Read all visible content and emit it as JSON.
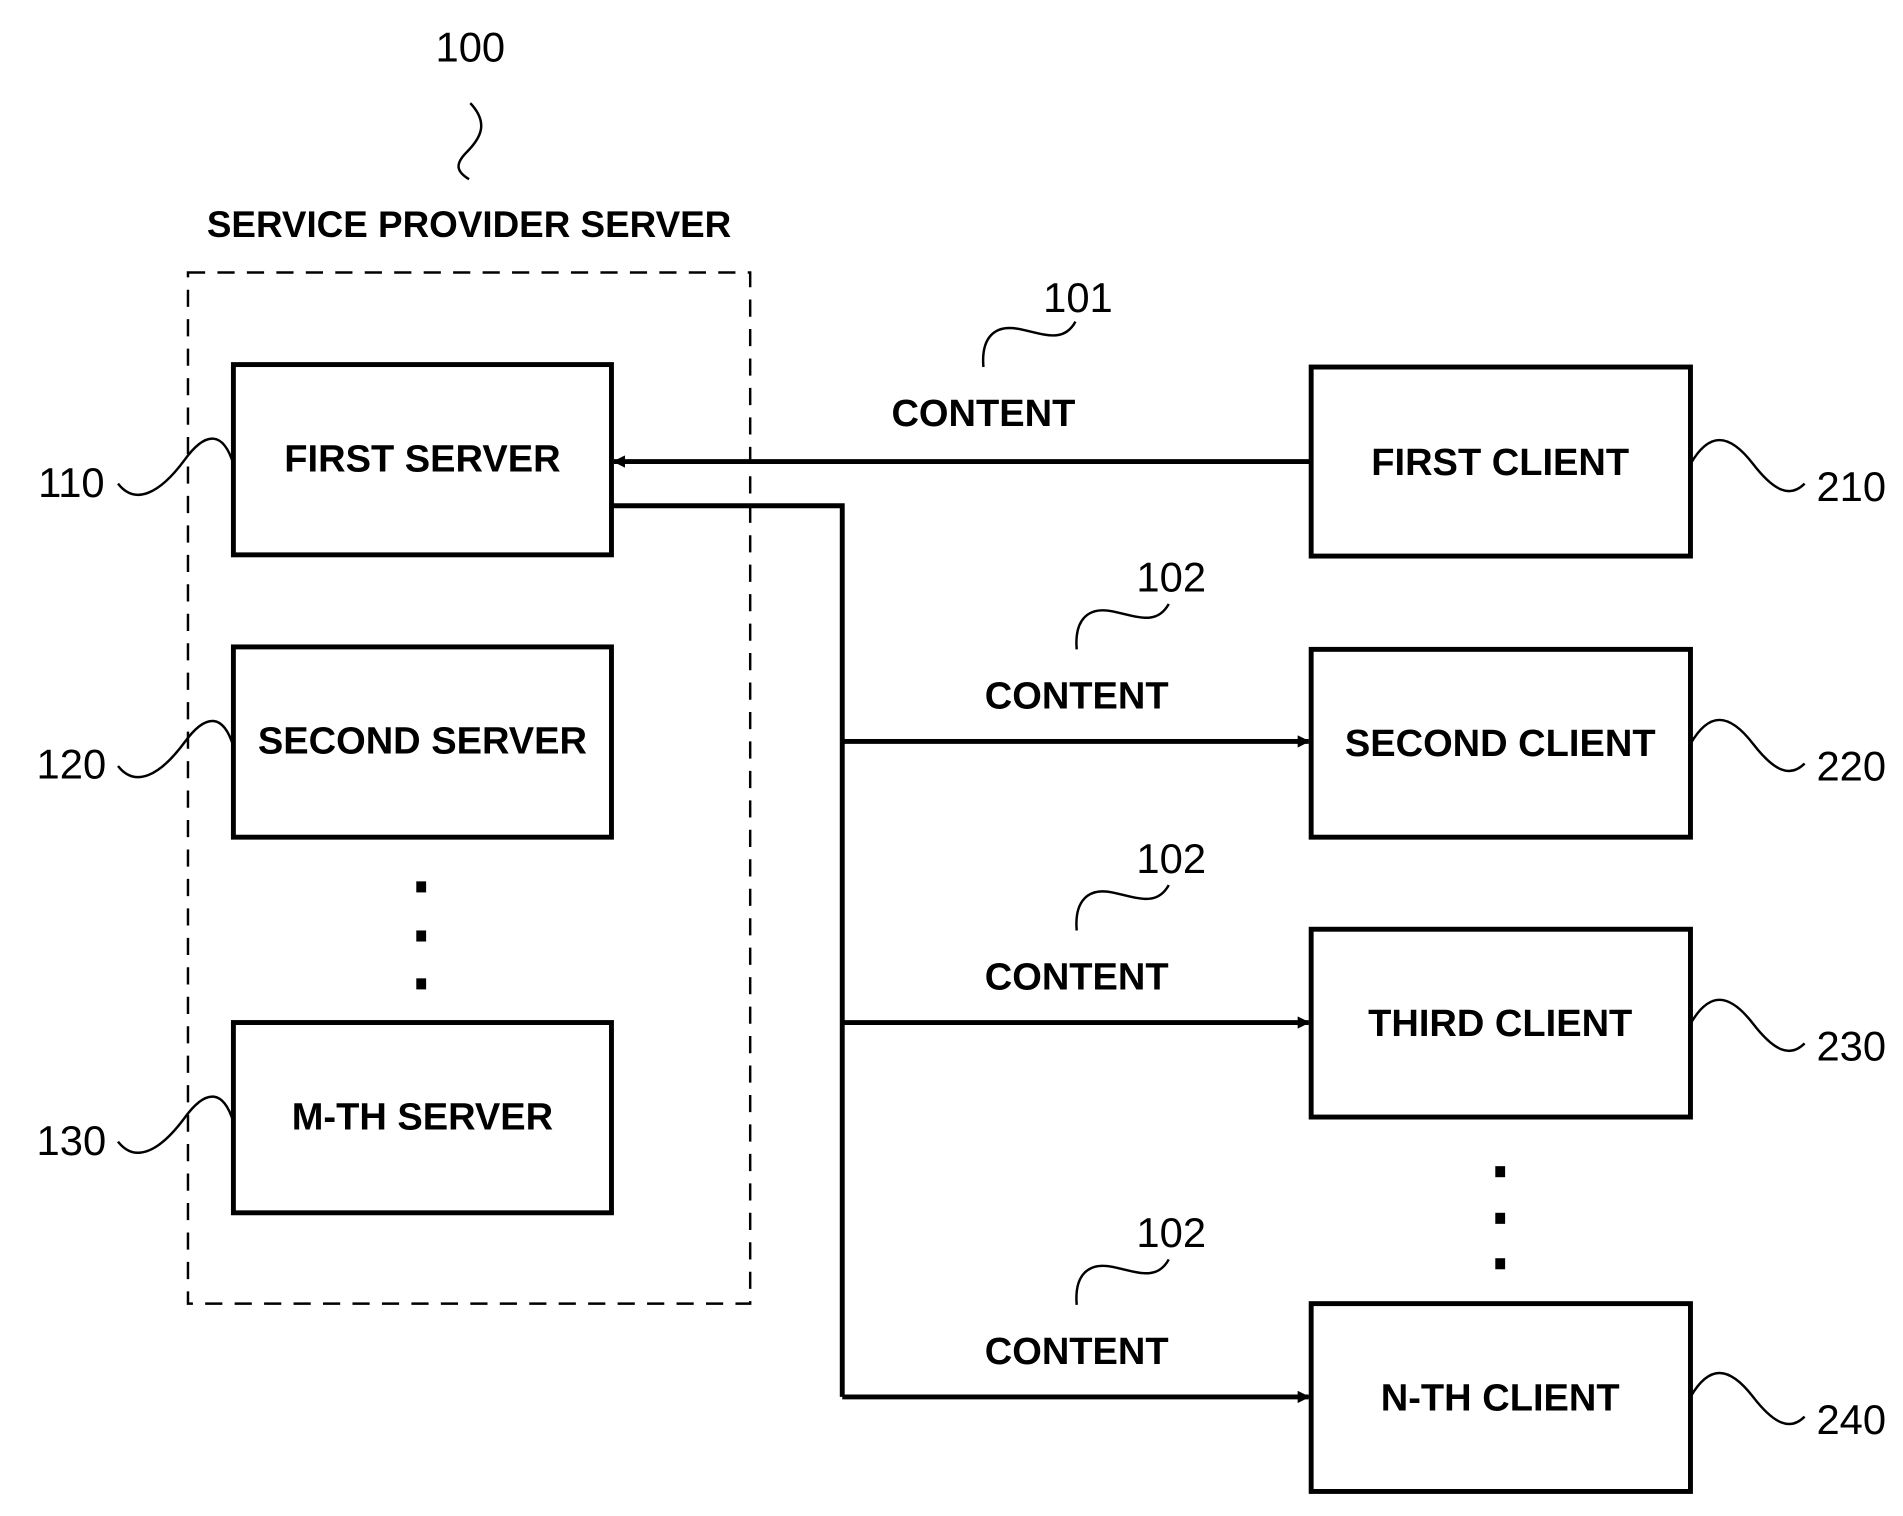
{
  "group": {
    "ref": "100",
    "title": "SERVICE PROVIDER SERVER"
  },
  "servers": [
    {
      "ref": "110",
      "label": "FIRST SERVER"
    },
    {
      "ref": "120",
      "label": "SECOND SERVER"
    },
    {
      "ref": "130",
      "label": "M-TH SERVER"
    }
  ],
  "clients": [
    {
      "ref": "210",
      "label": "FIRST CLIENT"
    },
    {
      "ref": "220",
      "label": "SECOND CLIENT"
    },
    {
      "ref": "230",
      "label": "THIRD CLIENT"
    },
    {
      "ref": "240",
      "label": "N-TH CLIENT"
    }
  ],
  "flows": [
    {
      "ref": "101",
      "label": "CONTENT",
      "direction": "client-to-server",
      "from": "FIRST CLIENT",
      "to": "FIRST SERVER"
    },
    {
      "ref": "102",
      "label": "CONTENT",
      "direction": "server-to-client",
      "from": "FIRST SERVER",
      "to": "SECOND CLIENT"
    },
    {
      "ref": "102",
      "label": "CONTENT",
      "direction": "server-to-client",
      "from": "FIRST SERVER",
      "to": "THIRD CLIENT"
    },
    {
      "ref": "102",
      "label": "CONTENT",
      "direction": "server-to-client",
      "from": "FIRST SERVER",
      "to": "N-TH CLIENT"
    }
  ],
  "ellipsis": "⋮"
}
